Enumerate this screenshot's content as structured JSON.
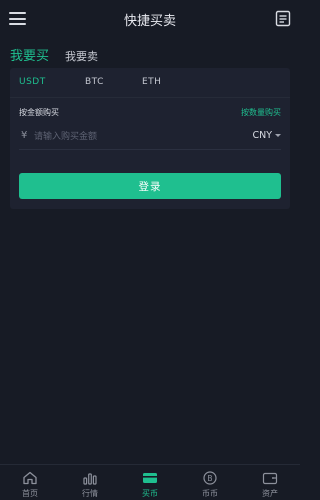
{
  "header": {
    "title": "快捷买卖"
  },
  "mode_tabs": [
    "我要买",
    "我要卖"
  ],
  "coin_tabs": [
    "USDT",
    "BTC",
    "ETH"
  ],
  "form": {
    "amount_label": "按金额购买",
    "quantity_link": "按数量购买",
    "currency_symbol": "¥",
    "amount_placeholder": "请输入购买金额",
    "currency": "CNY",
    "submit_label": "登录"
  },
  "bottom_nav": [
    {
      "label": "首页",
      "icon": "home-icon"
    },
    {
      "label": "行情",
      "icon": "chart-icon"
    },
    {
      "label": "买币",
      "icon": "wallet-card-icon"
    },
    {
      "label": "币币",
      "icon": "bitcoin-icon"
    },
    {
      "label": "资产",
      "icon": "assets-icon"
    }
  ],
  "colors": {
    "accent": "#1fbf8f",
    "background": "#171b25",
    "card": "#1e2230",
    "muted": "#8d919c"
  }
}
